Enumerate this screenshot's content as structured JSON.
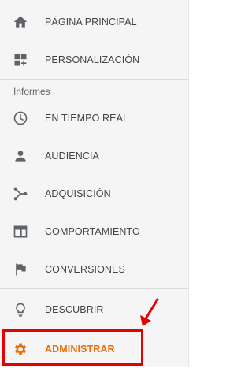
{
  "nav": {
    "top_items": [
      {
        "label": "PÁGINA PRINCIPAL",
        "icon": "home-icon"
      },
      {
        "label": "PERSONALIZACIÓN",
        "icon": "dashboard-plus-icon"
      }
    ],
    "section_title": "Informes",
    "report_items": [
      {
        "label": "EN TIEMPO REAL",
        "icon": "clock-icon"
      },
      {
        "label": "AUDIENCIA",
        "icon": "person-icon"
      },
      {
        "label": "ADQUISICIÓN",
        "icon": "acquisition-icon"
      },
      {
        "label": "COMPORTAMIENTO",
        "icon": "behavior-window-icon"
      },
      {
        "label": "CONVERSIONES",
        "icon": "flag-icon"
      }
    ],
    "bottom_items": [
      {
        "label": "DESCUBRIR",
        "icon": "lightbulb-icon"
      },
      {
        "label": "ADMINISTRAR",
        "icon": "gear-icon"
      }
    ]
  },
  "colors": {
    "icon": "#5f6368",
    "label": "#444444",
    "admin_accent": "#e8710a",
    "highlight": "#e60000",
    "sidebar_bg": "#f5f5f5"
  }
}
